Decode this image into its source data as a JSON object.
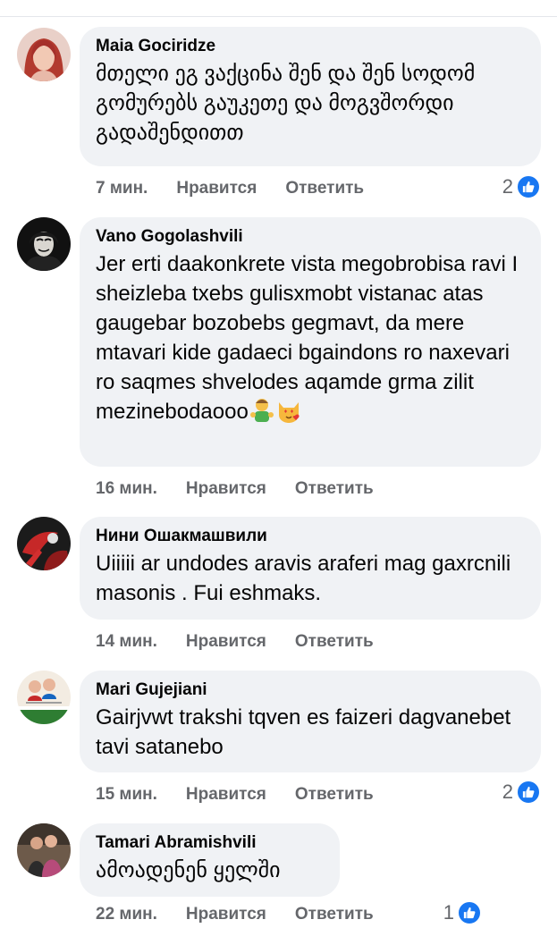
{
  "comments": [
    {
      "author": "Maia Gociridze",
      "text": "მთელი ეგ ვაქცინა შენ და შენ სოდომ გომურებს გაუკეთე და მოგვშორდი გადაშენდითთ",
      "time": "7 мин.",
      "like_label": "Нравится",
      "reply_label": "Ответить",
      "reactions": "2",
      "avatar": "avatar-woman-red-hair"
    },
    {
      "author": "Vano Gogolashvili",
      "text": "Jer erti daakonkrete vista megobrobisa ravi I sheizleba txebs gulisxmobt vistanac atas gaugebar bozobebs gegmavt, da mere mtavari kide gadaeci bgaindons ro naxevari ro saqmes shvelodes aqamde grma zilit mezinebodaooo",
      "emoji": [
        "person-gesturing-emoji",
        "heart-eyes-cat-emoji"
      ],
      "time": "16 мин.",
      "like_label": "Нравится",
      "reply_label": "Ответить",
      "avatar": "avatar-mask"
    },
    {
      "author": "Нини Ошакмашвили",
      "text": "Uiiiii ar undodes aravis araferi mag gaxrcnili masonis . Fui eshmaks.",
      "time": "14 мин.",
      "like_label": "Нравится",
      "reply_label": "Ответить",
      "avatar": "avatar-red-dark"
    },
    {
      "author": "Mari Gujejiani",
      "text": "Gairjvwt trakshi tqven es faizeri dagvanebet tavi satanebo",
      "time": "15 мин.",
      "like_label": "Нравится",
      "reply_label": "Ответить",
      "reactions": "2",
      "avatar": "avatar-group-photo"
    },
    {
      "author": "Tamari Abramishvili",
      "text": "ამოადენენ ყელში",
      "time": "22 мин.",
      "like_label": "Нравится",
      "reply_label": "Ответить",
      "reactions": "1",
      "avatar": "avatar-couple"
    }
  ],
  "colors": {
    "bubble": "#f0f2f5",
    "meta": "#65676b",
    "like_blue": "#1877f2"
  }
}
